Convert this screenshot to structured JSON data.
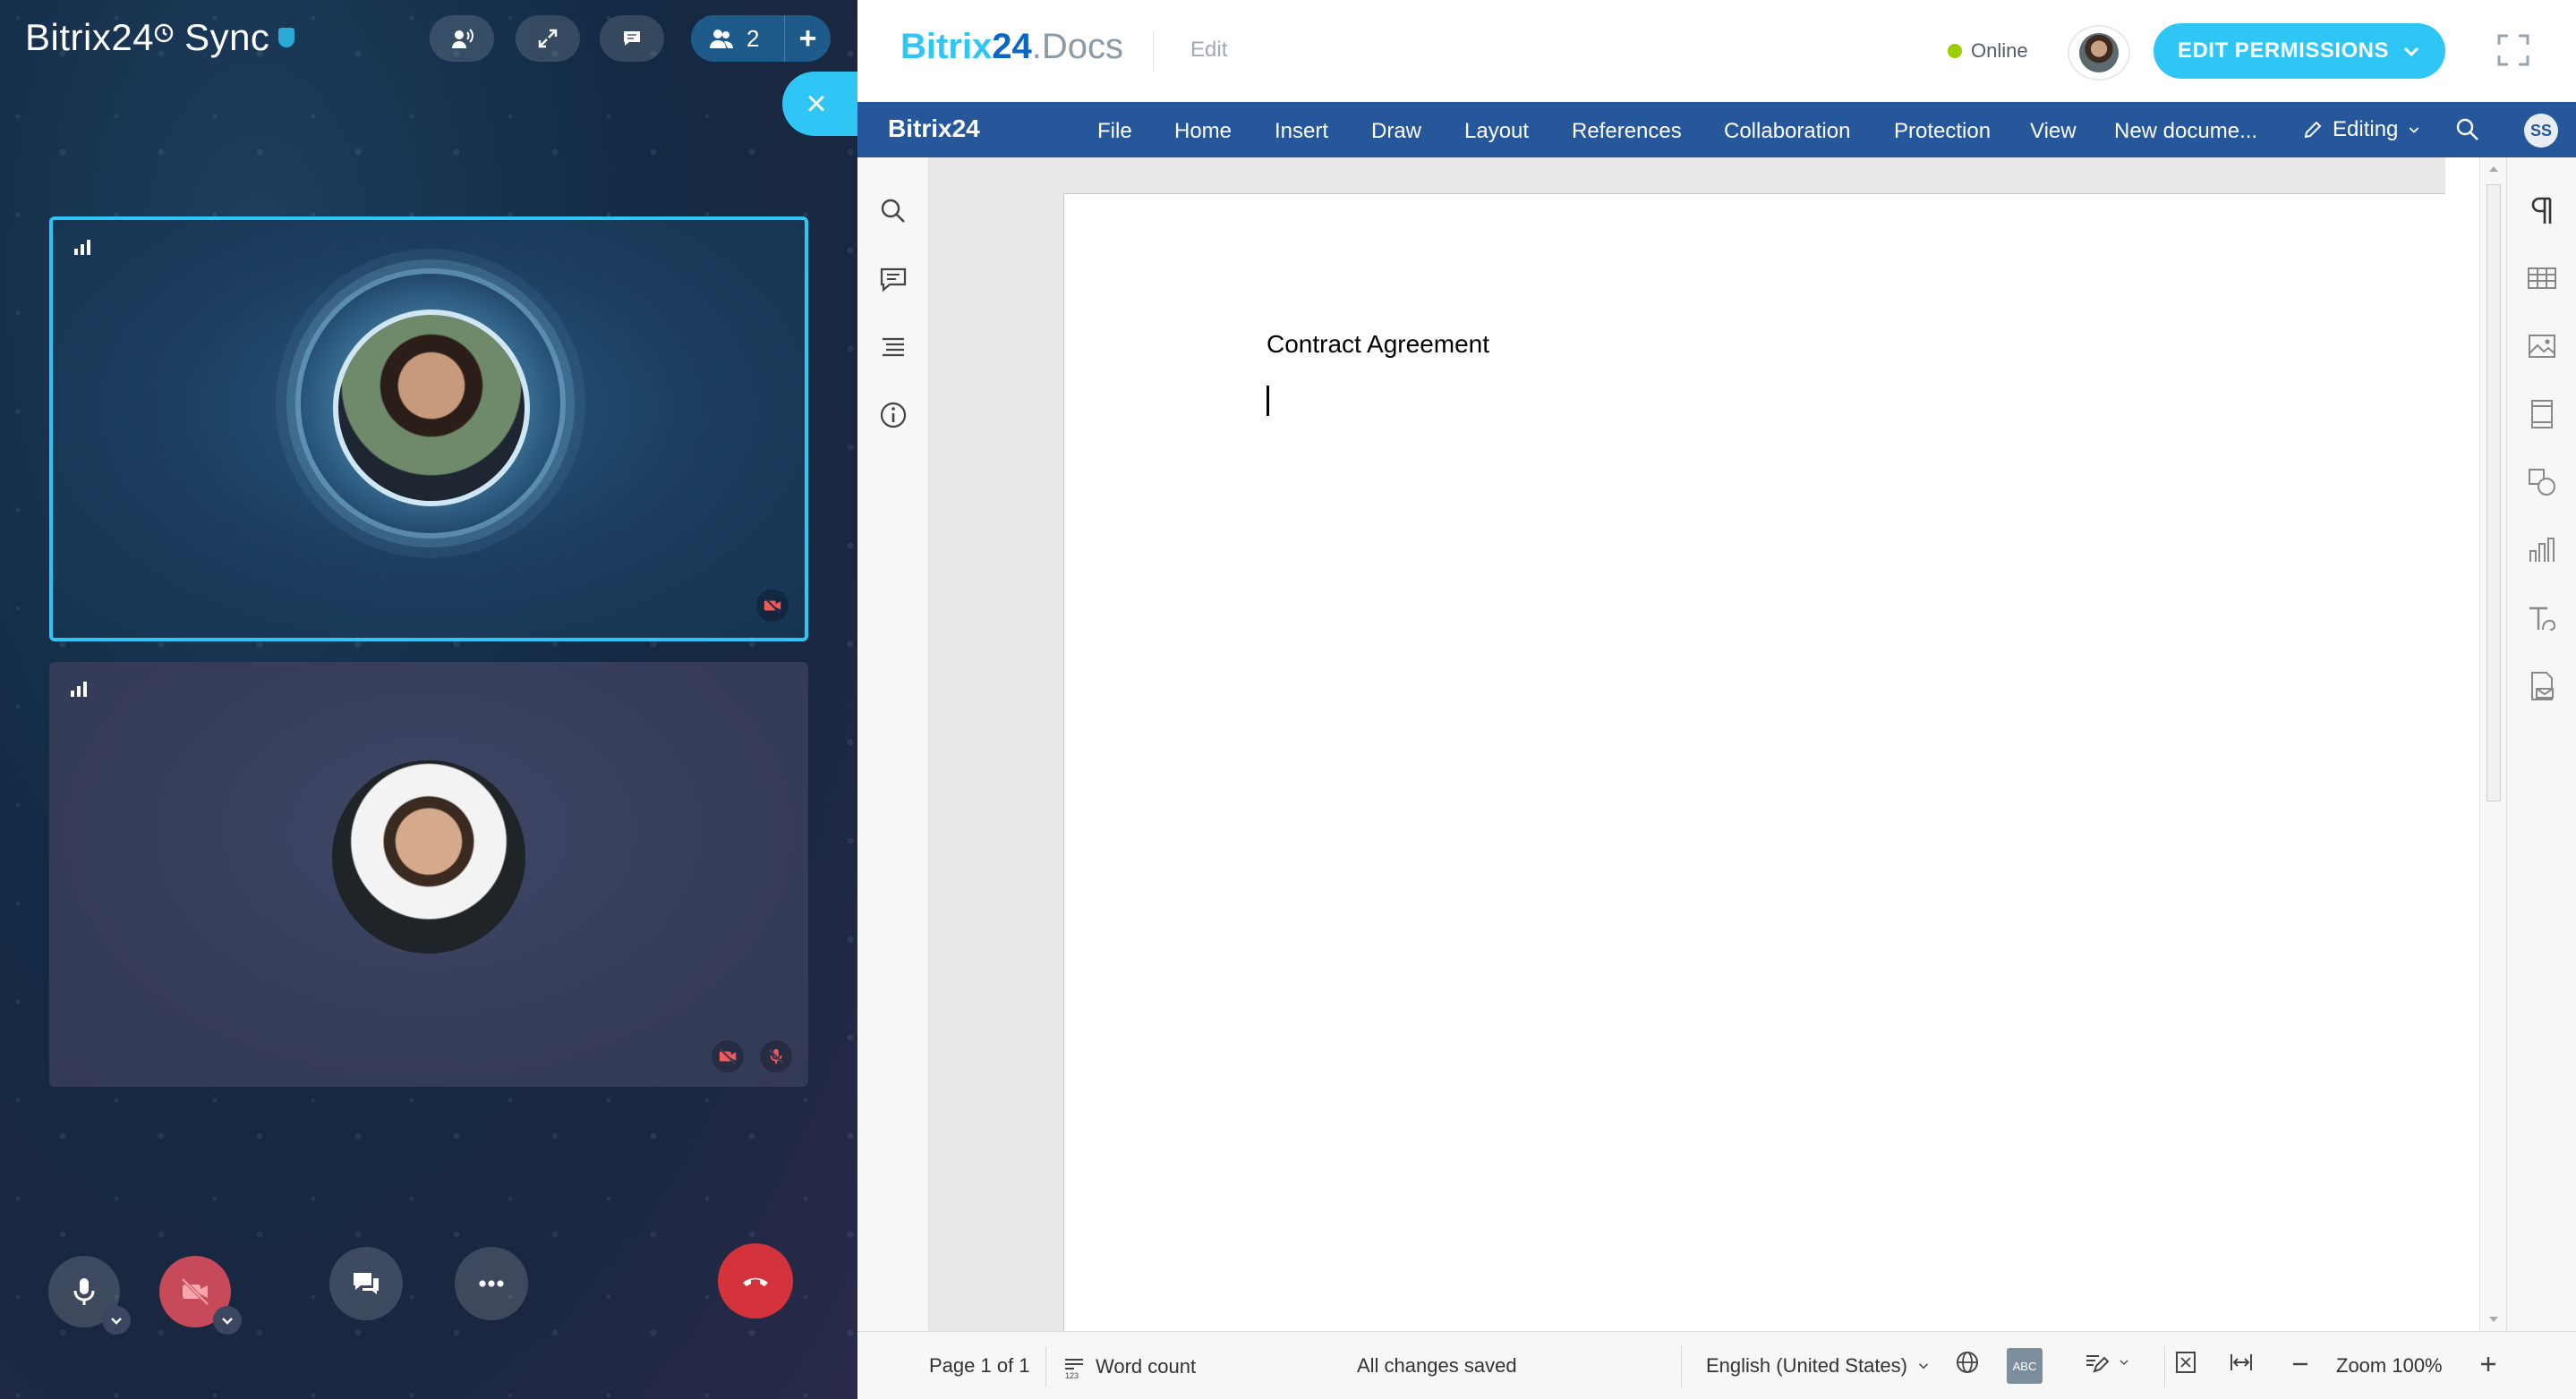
{
  "call": {
    "brand": "Bitrix24",
    "brand_suffix": "Sync",
    "participants_count": "2",
    "add_label": "+",
    "close_label": "×"
  },
  "docs": {
    "logo": {
      "part1": "Bitrix",
      "part2": "24",
      "part3": ".Docs"
    },
    "mode_label": "Edit",
    "status": "Online",
    "permissions_button": "EDIT PERMISSIONS",
    "menu_logo": "Bitrix24",
    "menu": [
      "File",
      "Home",
      "Insert",
      "Draw",
      "Layout",
      "References",
      "Collaboration",
      "Protection",
      "View"
    ],
    "doc_name": "New docume...",
    "edit_mode": "Editing",
    "user_initials": "SS",
    "document": {
      "title": "Contract Agreement"
    },
    "statusbar": {
      "page": "Page 1 of 1",
      "word_count": "Word count",
      "saved": "All changes saved",
      "language": "English (United States)",
      "spell": "ABC",
      "zoom": "Zoom 100%"
    }
  },
  "colors": {
    "accent": "#2fc6f6",
    "menubar": "#25579a",
    "end_call": "#d5333b",
    "online": "#9dcf00"
  }
}
